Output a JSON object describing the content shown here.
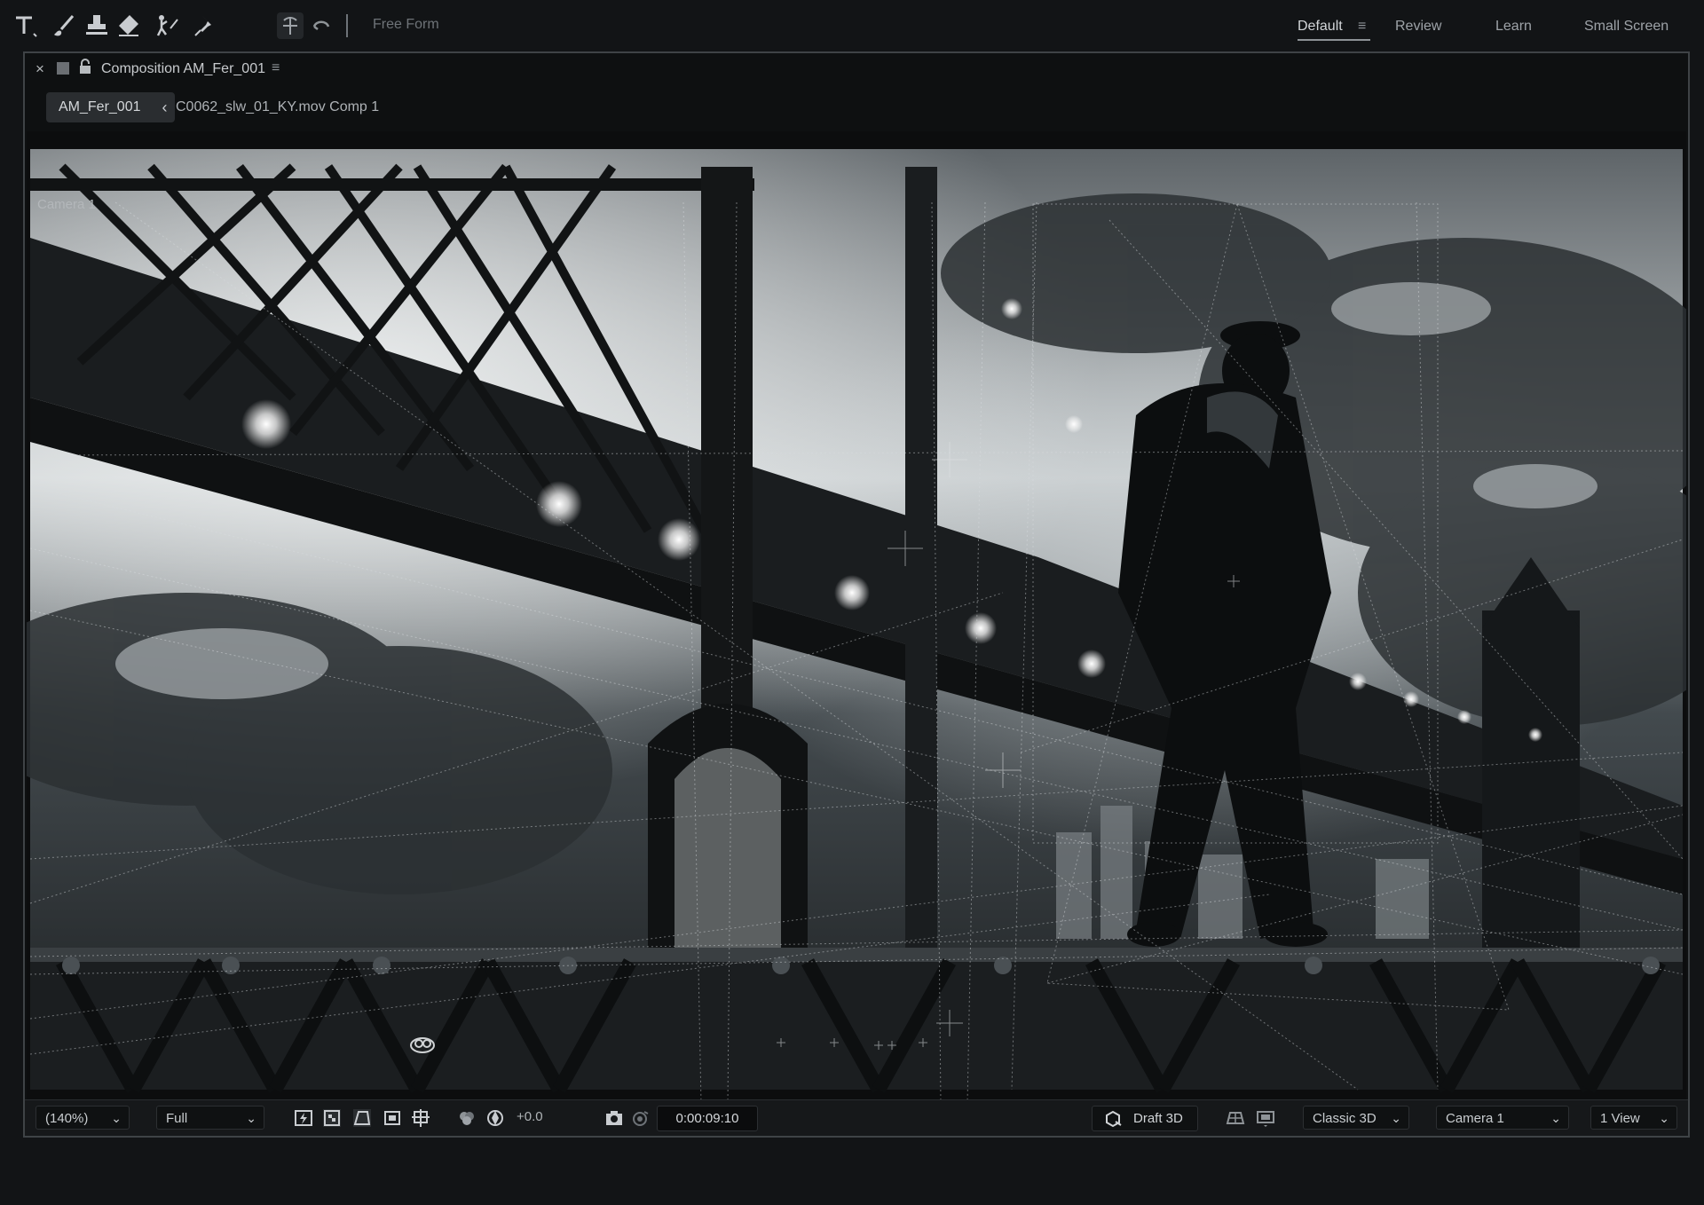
{
  "toolbar": {
    "tools": [
      "type-tool-icon",
      "brush-tool-icon",
      "clone-stamp-tool-icon",
      "eraser-tool-icon",
      "roto-brush-tool-icon",
      "puppet-pin-tool-icon",
      "orbit-tool-icon",
      "undo-arc-icon",
      "vertical-line-icon"
    ],
    "free_form": "Free Form"
  },
  "workspaces": {
    "items": [
      "Default",
      "Review",
      "Learn",
      "Small Screen"
    ],
    "active": "Default"
  },
  "composition_panel": {
    "close": "×",
    "title": "Composition AM_Fer_001",
    "menu": "≡",
    "breadcrumb_active": "AM_Fer_001",
    "breadcrumb_chevron": "‹",
    "breadcrumb_next": "C0062_slw_01_KY.mov Comp 1"
  },
  "viewer": {
    "camera_label": "Camera 1"
  },
  "bottom_bar": {
    "zoom": "(140%)",
    "resolution": "Full",
    "exposure": "+0.0",
    "timecode": "0:00:09:10",
    "renderer_mode": "Draft 3D",
    "renderer": "Classic 3D",
    "camera": "Camera 1",
    "views": "1 View"
  },
  "colors": {
    "background": "#121416",
    "panel_border": "#3f4346",
    "text": "#bfc3c7",
    "accent": "#8d9296"
  }
}
